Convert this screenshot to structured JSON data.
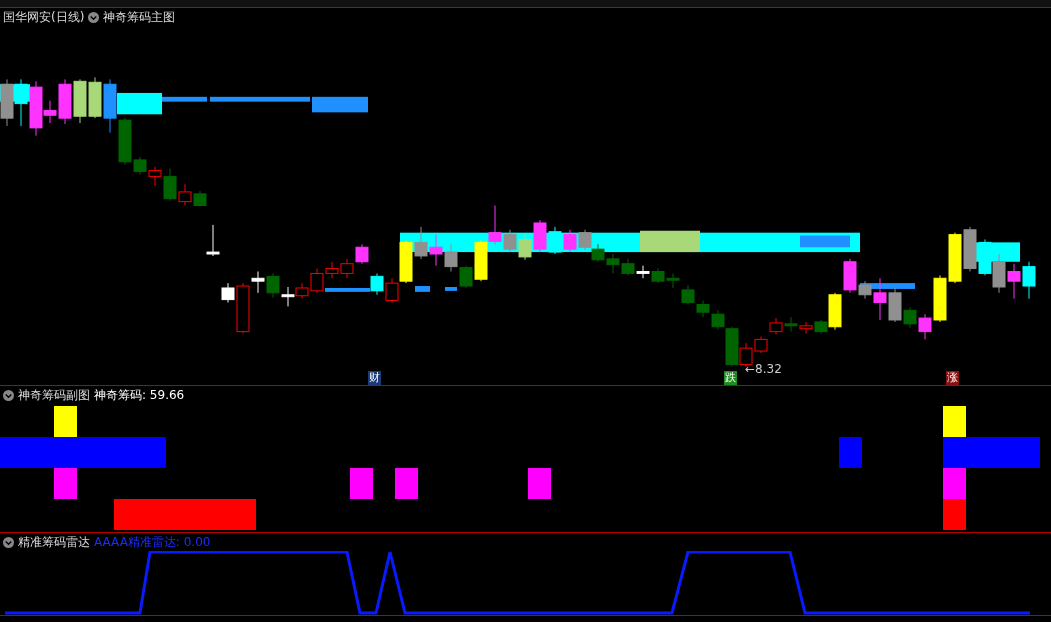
{
  "main_chart": {
    "stock_title": "国华网安(日线)",
    "indicator_title": "神奇筹码主图",
    "low_label": "←8.32",
    "markers": [
      {
        "text": "财",
        "color": "#1c3a78"
      },
      {
        "text": "跌",
        "color": "#1f8a1f"
      },
      {
        "text": "涨",
        "color": "#8a1010"
      }
    ]
  },
  "sub_chart": {
    "title": "神奇筹码副图",
    "value_label": "神奇筹码: 59.66"
  },
  "radar_chart": {
    "title": "精准筹码雷达",
    "value_label": "AAAA精准雷达: 0.00"
  }
}
